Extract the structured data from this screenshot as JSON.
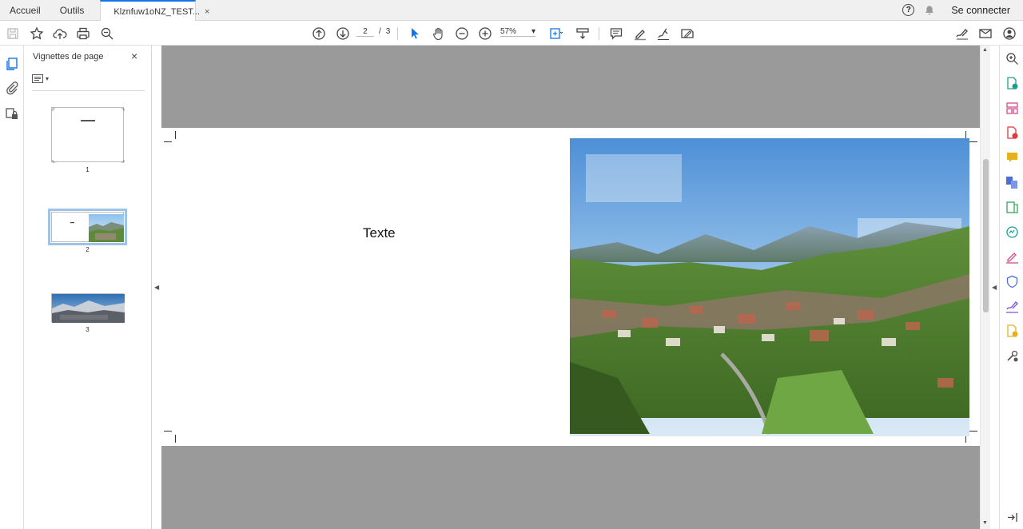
{
  "tabs": {
    "home": "Accueil",
    "tools": "Outils",
    "document": "Klznfuw1oNZ_TEST...",
    "close_symbol": "×"
  },
  "header": {
    "help_symbol": "?",
    "signin": "Se connecter"
  },
  "toolbar": {
    "current_page": "2",
    "page_separator": "/",
    "total_pages": "3",
    "zoom": "57%"
  },
  "thumbnail_panel": {
    "title": "Vignettes de page",
    "close_symbol": "×",
    "pages": [
      {
        "number": "1",
        "selected": false
      },
      {
        "number": "2",
        "selected": true
      },
      {
        "number": "3",
        "selected": false
      }
    ]
  },
  "document": {
    "page_text": "Texte"
  },
  "colors": {
    "accent": "#1473e6",
    "canvas": "#9a9a9a",
    "selection": "#9fc3e8"
  },
  "icons": {
    "toolbar": [
      "save-icon",
      "bookmark-star-icon",
      "upload-cloud-icon",
      "print-icon",
      "zoom-out-search-icon",
      "previous-page-icon",
      "next-page-icon",
      "select-arrow-icon",
      "hand-icon",
      "zoom-out-icon",
      "zoom-in-icon",
      "fit-page-icon",
      "scroll-mode-icon",
      "comment-icon",
      "highlight-pen-icon",
      "draw-icon",
      "fill-sign-icon",
      "sign-icon",
      "email-icon",
      "account-icon"
    ],
    "right_tools": [
      "search-icon",
      "export-pdf-icon",
      "organize-pages-icon",
      "create-pdf-icon",
      "comment-tool-icon",
      "combine-icon",
      "edit-pdf-icon",
      "scan-icon",
      "fill-sign-tool-icon",
      "protect-icon",
      "sign-tool-icon",
      "send-for-review-icon",
      "more-tools-icon"
    ]
  }
}
